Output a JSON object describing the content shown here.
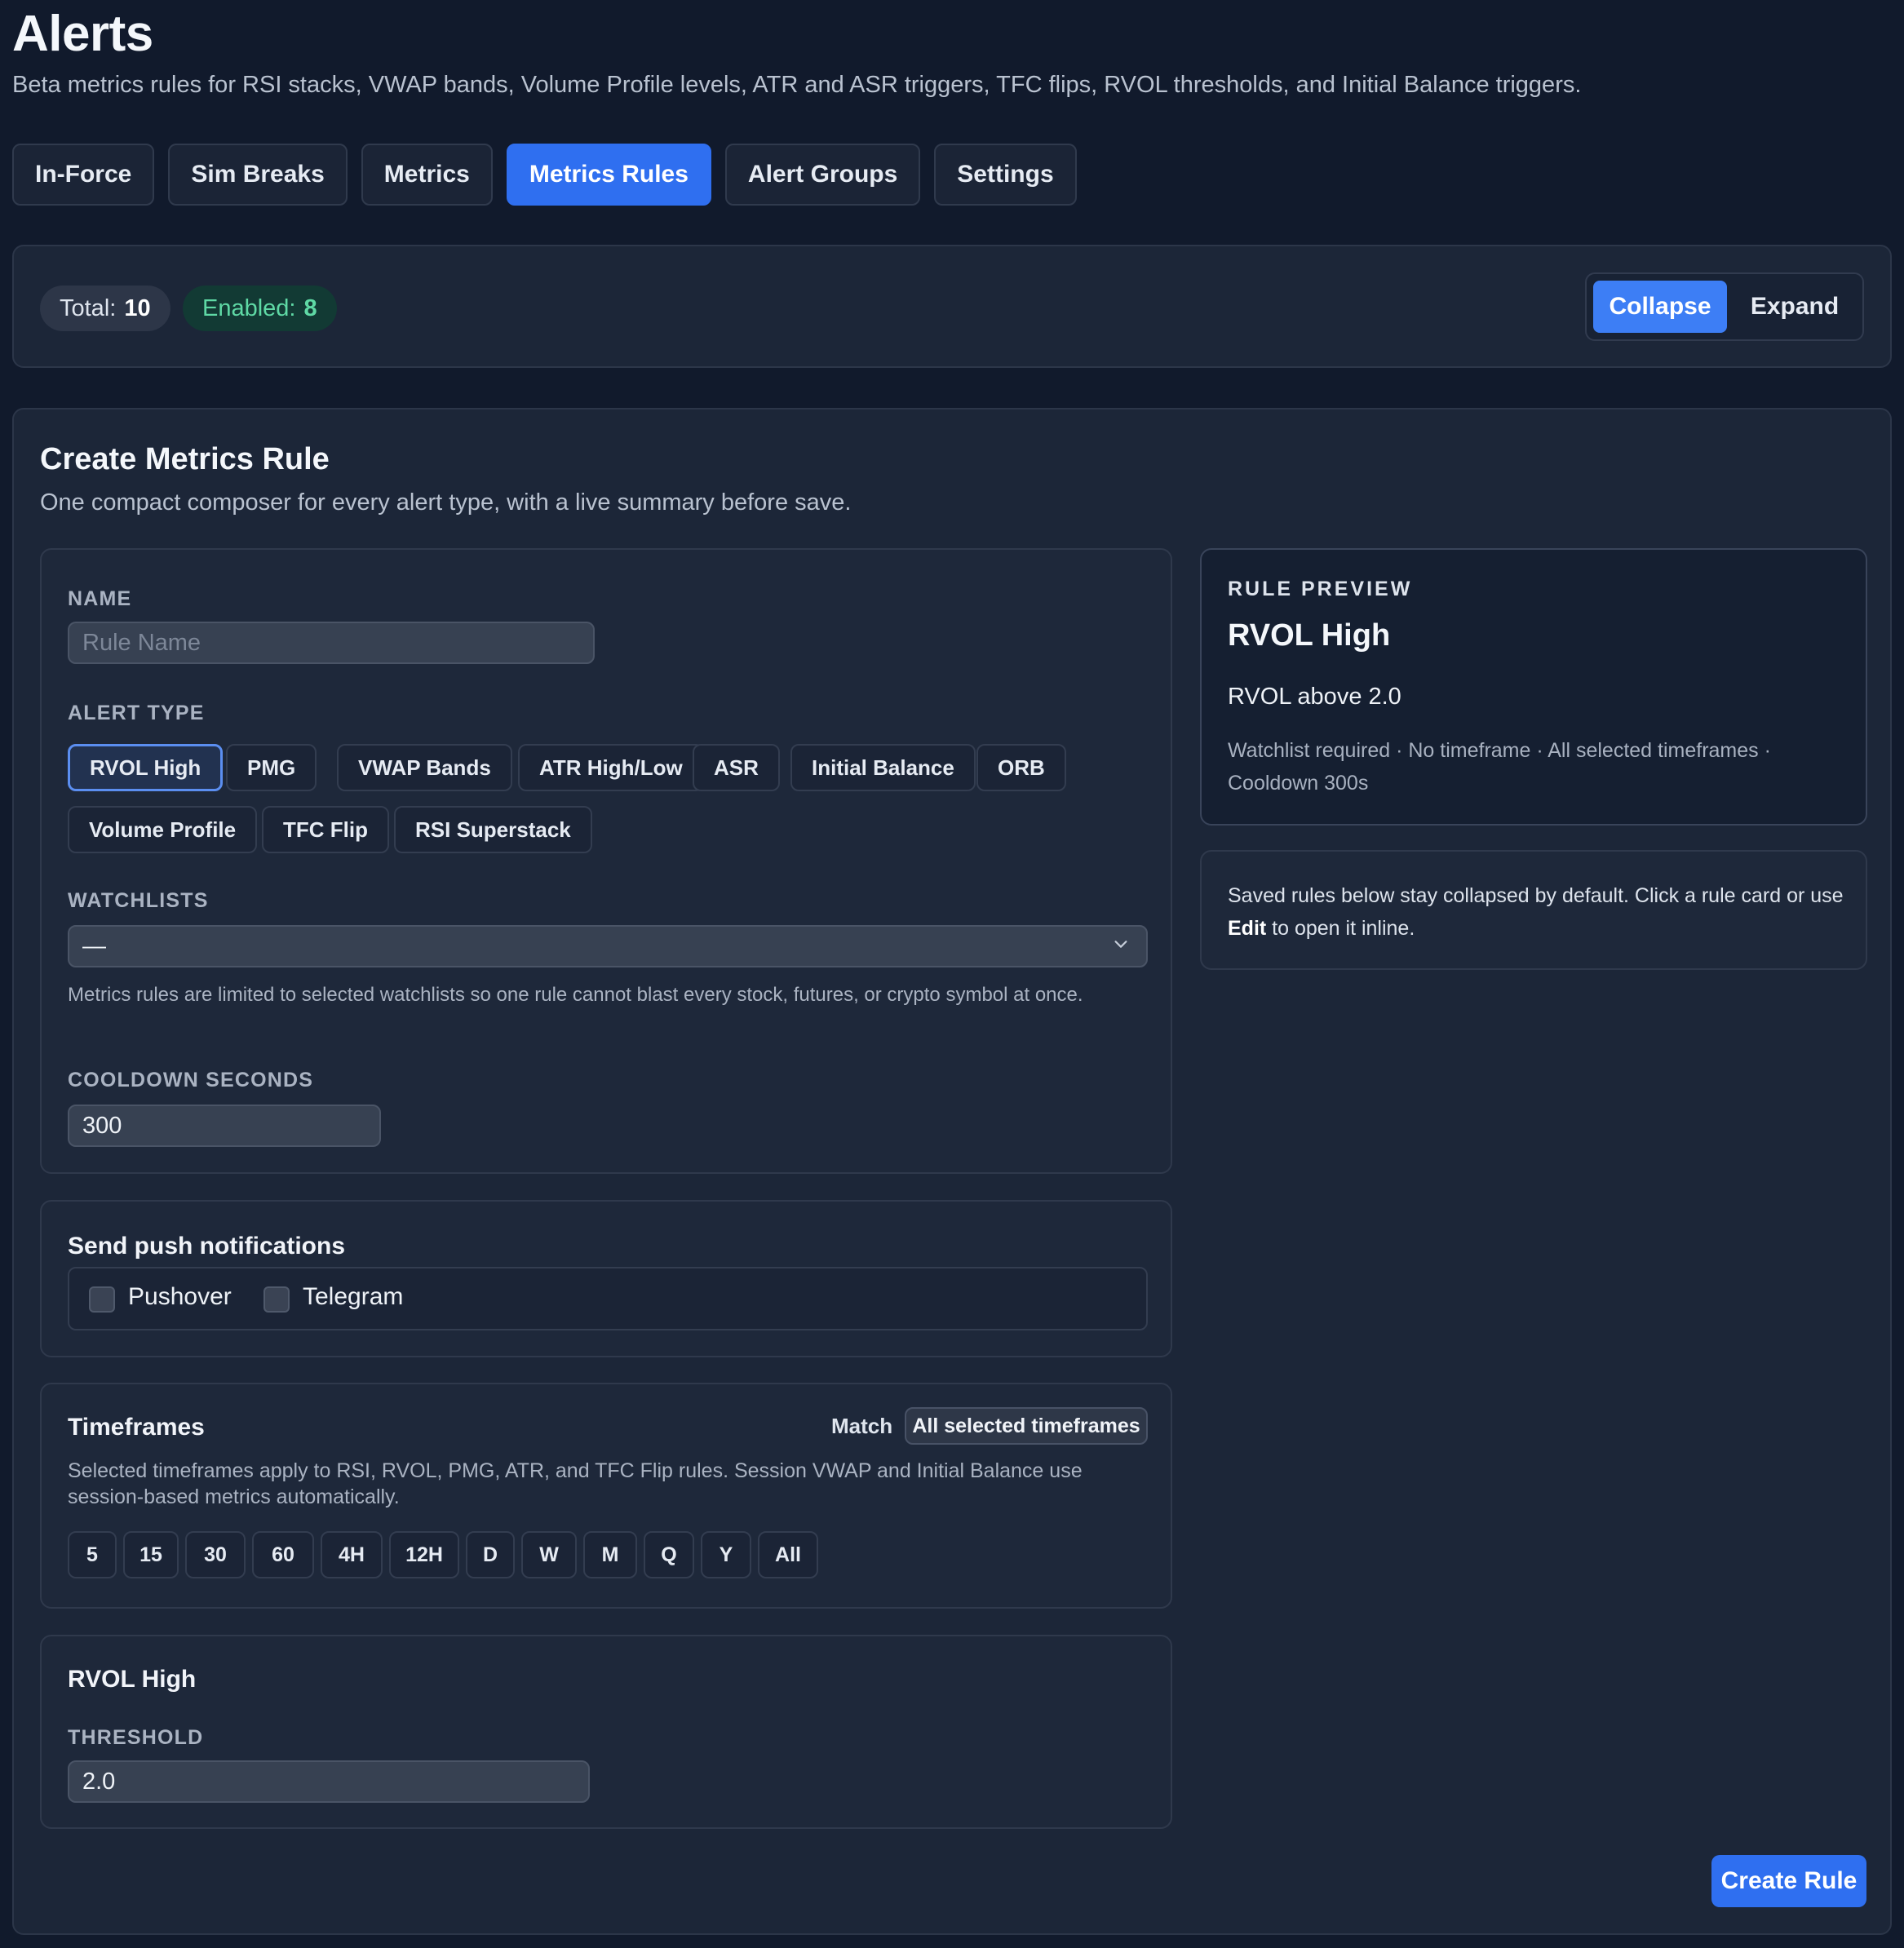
{
  "header": {
    "title": "Alerts",
    "subtitle": "Beta metrics rules for RSI stacks, VWAP bands, Volume Profile levels, ATR and ASR triggers, TFC flips, RVOL thresholds, and Initial Balance triggers."
  },
  "tabs": [
    "In-Force",
    "Sim Breaks",
    "Metrics",
    "Metrics Rules",
    "Alert Groups",
    "Settings"
  ],
  "active_tab": "Metrics Rules",
  "stats": {
    "total_label": "Total:",
    "total_value": "10",
    "enabled_label": "Enabled:",
    "enabled_value": "8",
    "collapse_label": "Collapse",
    "expand_label": "Expand"
  },
  "composer": {
    "title": "Create Metrics Rule",
    "subtitle": "One compact composer for every alert type, with a live summary before save.",
    "name_label": "NAME",
    "name_placeholder": "Rule Name",
    "name_value": "",
    "alert_type_label": "ALERT TYPE",
    "alert_types": [
      "RVOL High",
      "PMG",
      "VWAP Bands",
      "ATR High/Low",
      "ASR",
      "Initial Balance",
      "ORB",
      "Volume Profile",
      "TFC Flip",
      "RSI Superstack"
    ],
    "selected_alert_type": "RVOL High",
    "watchlists_label": "WATCHLISTS",
    "watchlists_value": "—",
    "watchlists_hint": "Metrics rules are limited to selected watchlists so one rule cannot blast every stock, futures, or crypto symbol at once.",
    "cooldown_label": "COOLDOWN SECONDS",
    "cooldown_value": "300"
  },
  "preview": {
    "label": "RULE PREVIEW",
    "title": "RVOL High",
    "condition": "RVOL above 2.0",
    "meta": "Watchlist required · No timeframe · All selected timeframes · Cooldown 300s"
  },
  "note": {
    "text_before": "Saved rules below stay collapsed by default. Click a rule card or use ",
    "bold": "Edit",
    "text_after": " to open it inline."
  },
  "push": {
    "title": "Send push notifications",
    "options": [
      "Pushover",
      "Telegram"
    ]
  },
  "timeframes": {
    "title": "Timeframes",
    "match_label": "Match",
    "match_value": "All selected timeframes",
    "hint": "Selected timeframes apply to RSI, RVOL, PMG, ATR, and TFC Flip rules. Session VWAP and Initial Balance use session-based metrics automatically.",
    "items": [
      "5",
      "15",
      "30",
      "60",
      "4H",
      "12H",
      "D",
      "W",
      "M",
      "Q",
      "Y",
      "All"
    ]
  },
  "rvol": {
    "title": "RVOL High",
    "threshold_label": "THRESHOLD",
    "threshold_value": "2.0"
  },
  "create_label": "Create Rule",
  "colors": {
    "background": "#111a2c",
    "accent": "#2f6ff0",
    "enabled_green": "#5fd9a5"
  }
}
